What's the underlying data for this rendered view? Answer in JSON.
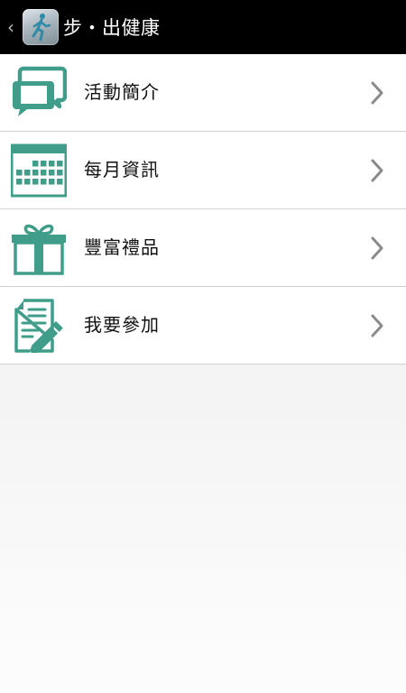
{
  "header": {
    "back_icon": "chevron-left-icon",
    "app_icon": "walking-person-icon",
    "title": "步・出健康"
  },
  "menu": {
    "items": [
      {
        "label": "活動簡介",
        "icon": "speech-bubbles-icon"
      },
      {
        "label": "每月資訊",
        "icon": "calendar-icon"
      },
      {
        "label": "豐富禮品",
        "icon": "gift-icon"
      },
      {
        "label": "我要參加",
        "icon": "form-pencil-icon"
      }
    ]
  },
  "colors": {
    "accent": "#3f9d8a",
    "header_bg": "#000000",
    "row_bg": "#ffffff",
    "divider": "#d2d2d2",
    "chevron": "#8a8a8a"
  }
}
